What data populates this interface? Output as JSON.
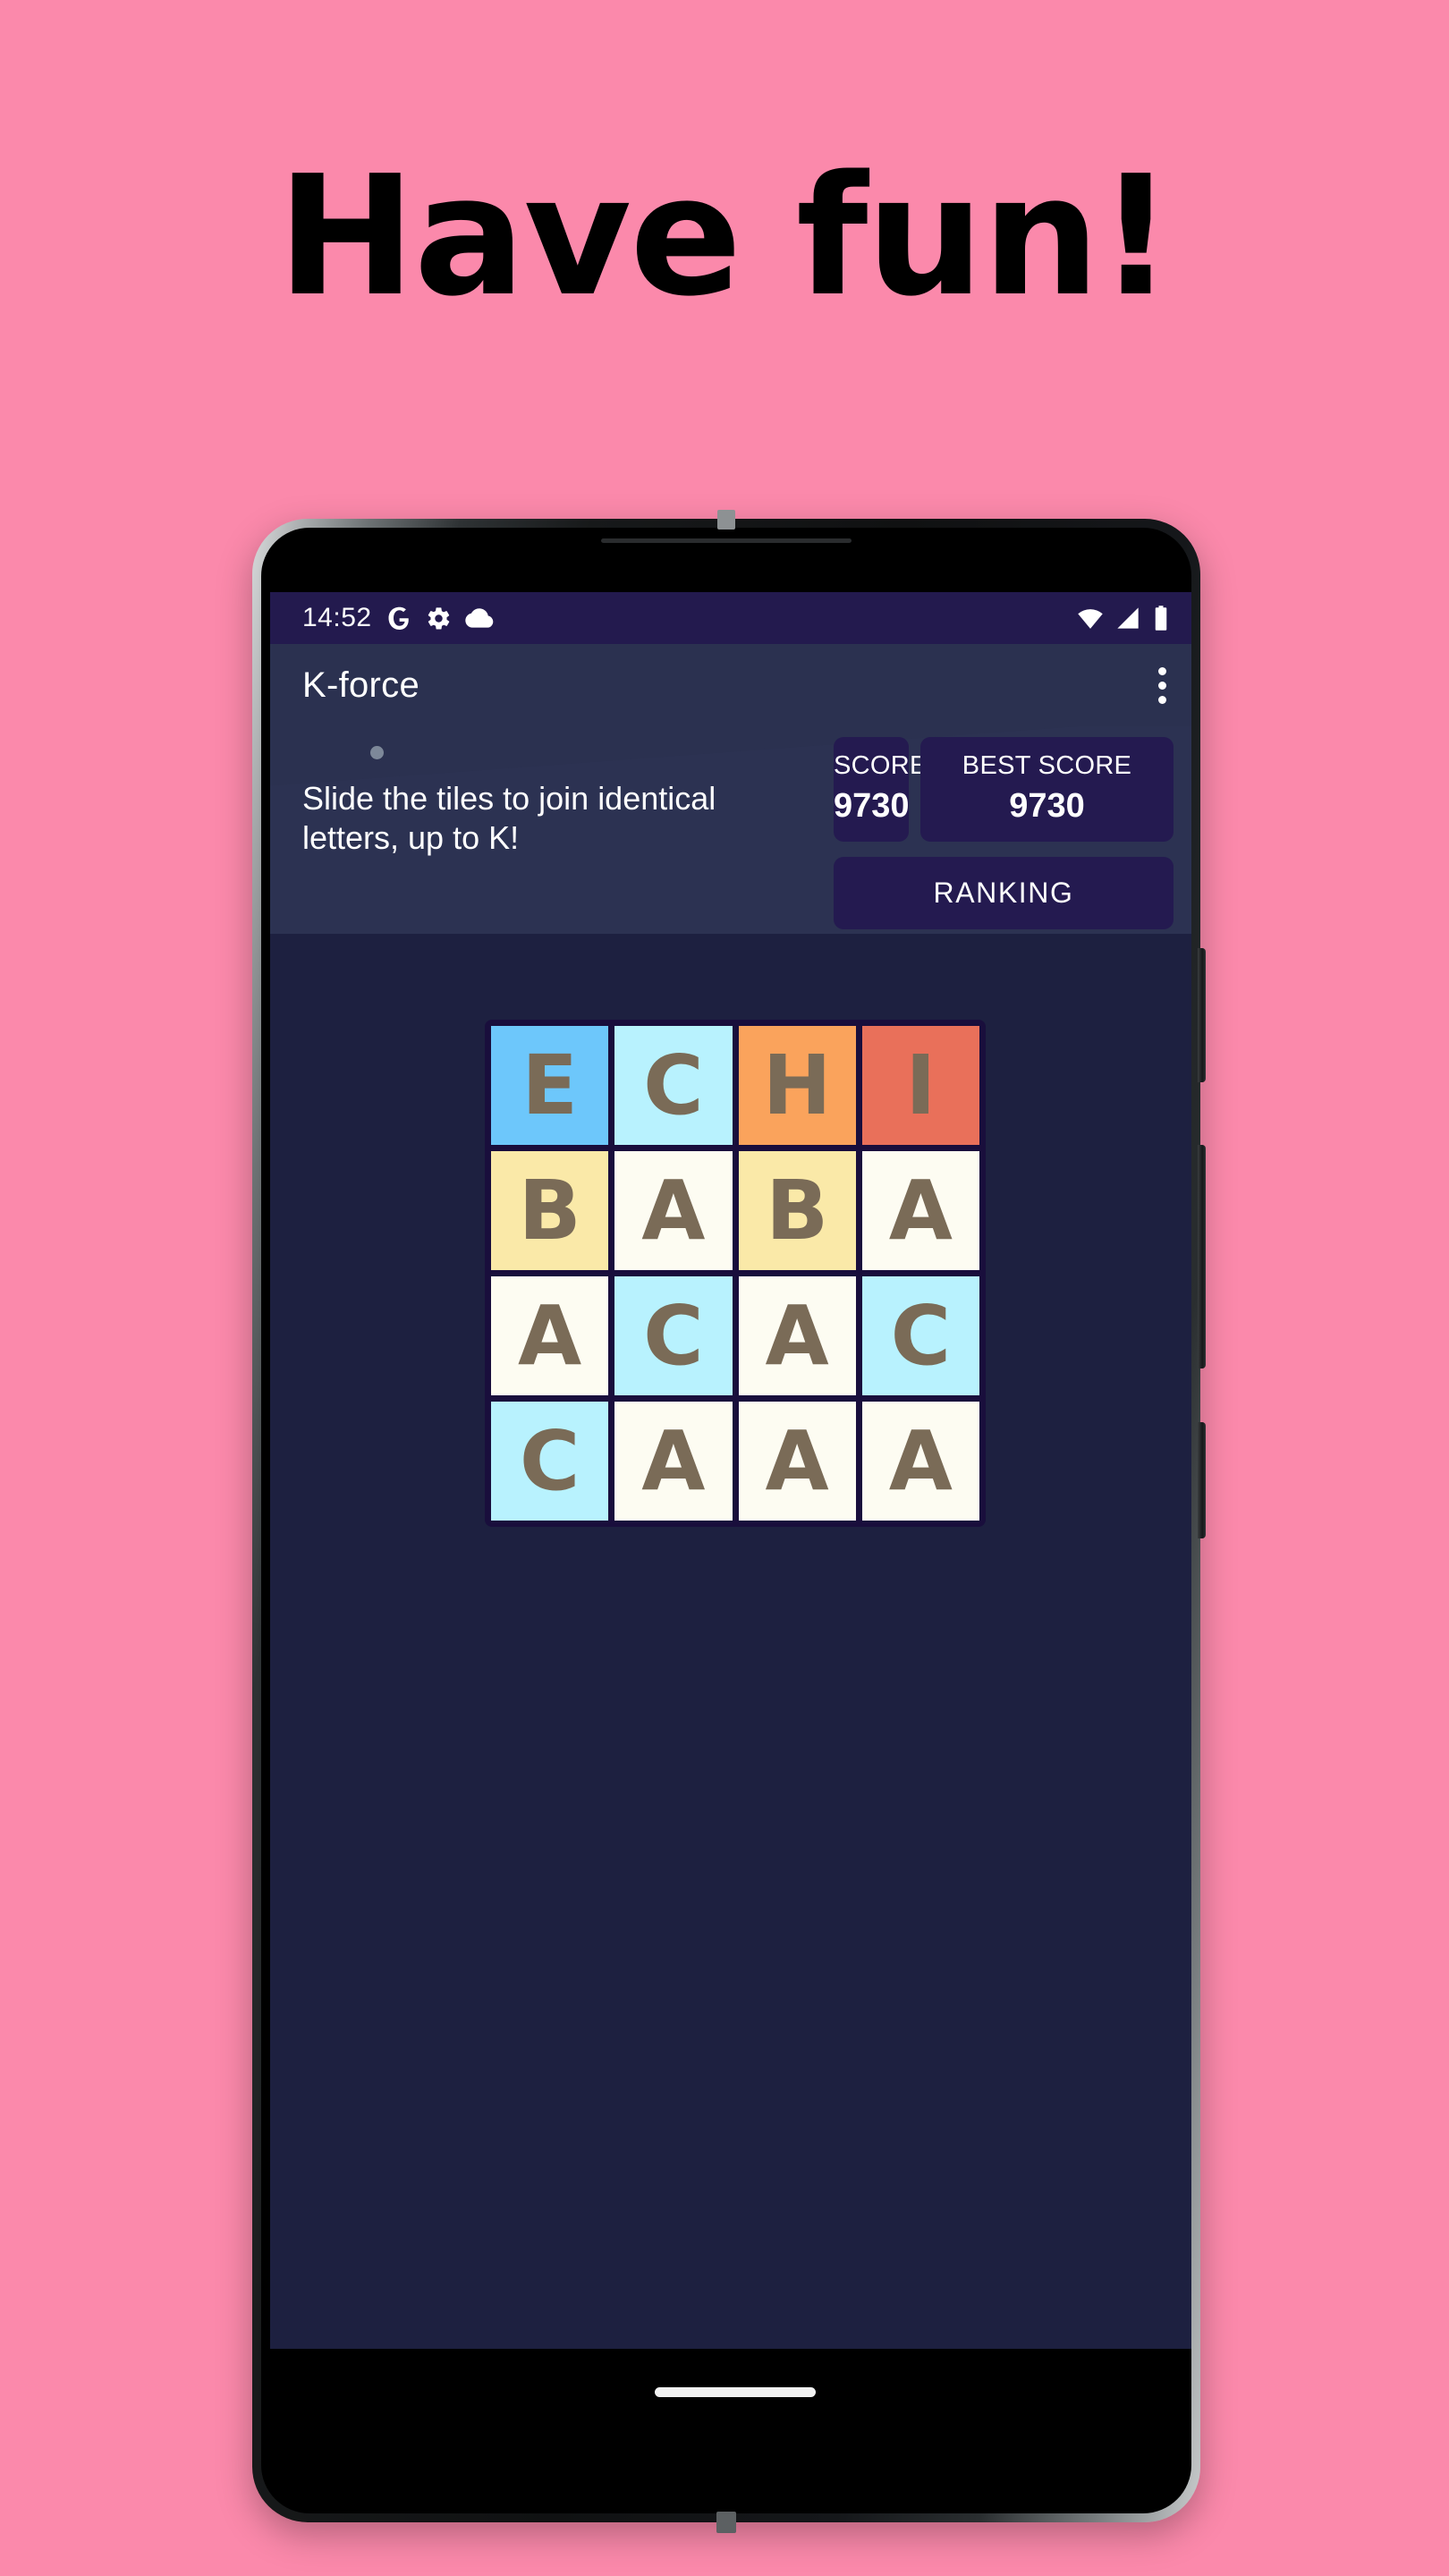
{
  "page": {
    "headline": "Have fun!",
    "background_color": "#fb89ab"
  },
  "statusbar": {
    "time": "14:52",
    "left_icons": [
      "google-g-icon",
      "gear-icon",
      "cloud-icon"
    ],
    "right_icons": [
      "wifi-icon",
      "cellular-signal-icon",
      "battery-icon"
    ],
    "background_color": "#231a4e"
  },
  "appbar": {
    "title": "K-force",
    "overflow_icon": "more-vert-icon",
    "background_color": "#2b3150"
  },
  "header": {
    "instructions": "Slide the tiles to join identical letters, up to K!",
    "score": {
      "label": "SCORE",
      "value": "9730"
    },
    "best_score": {
      "label": "BEST SCORE",
      "value": "9730"
    },
    "ranking_label": "RANKING",
    "panel_color": "#241a50"
  },
  "board": {
    "background_color": "#190e3c",
    "letter_color": "#7a6b57",
    "rows": [
      [
        {
          "letter": "E",
          "color": "#6dc7fb"
        },
        {
          "letter": "C",
          "color": "#b8f2fe"
        },
        {
          "letter": "H",
          "color": "#faa35c"
        },
        {
          "letter": "I",
          "color": "#e9705a"
        }
      ],
      [
        {
          "letter": "B",
          "color": "#fae9a8"
        },
        {
          "letter": "A",
          "color": "#fdfcf2"
        },
        {
          "letter": "B",
          "color": "#fae9a8"
        },
        {
          "letter": "A",
          "color": "#fdfcf2"
        }
      ],
      [
        {
          "letter": "A",
          "color": "#fdfcf2"
        },
        {
          "letter": "C",
          "color": "#b8f2fe"
        },
        {
          "letter": "A",
          "color": "#fdfcf2"
        },
        {
          "letter": "C",
          "color": "#b8f2fe"
        }
      ],
      [
        {
          "letter": "C",
          "color": "#b8f2fe"
        },
        {
          "letter": "A",
          "color": "#fdfcf2"
        },
        {
          "letter": "A",
          "color": "#fdfcf2"
        },
        {
          "letter": "A",
          "color": "#fdfcf2"
        }
      ]
    ]
  },
  "navbar": {
    "gesture_pill": "home-gesture-pill"
  }
}
